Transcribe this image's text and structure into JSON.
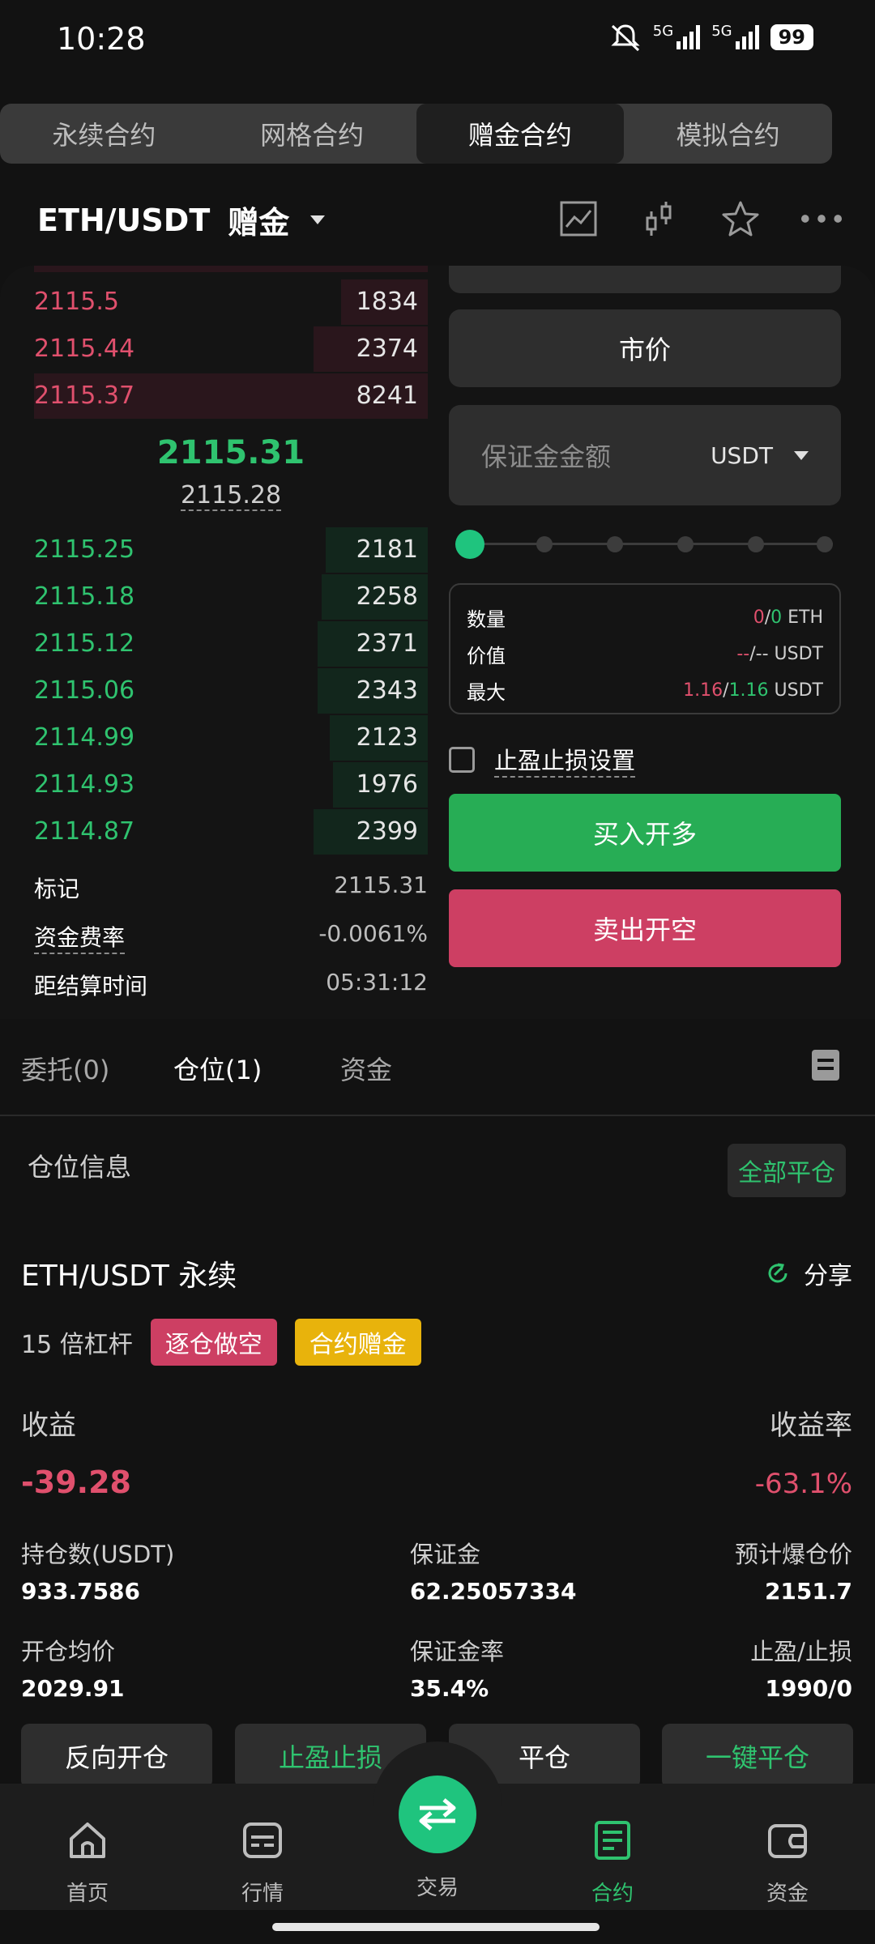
{
  "status": {
    "time": "10:28",
    "net1": "5G",
    "net2": "5G",
    "battery": "99"
  },
  "contract_tabs": [
    {
      "label": "永续合约",
      "active": false
    },
    {
      "label": "网格合约",
      "active": false
    },
    {
      "label": "赠金合约",
      "active": true
    },
    {
      "label": "模拟合约",
      "active": false
    }
  ],
  "header": {
    "pair": "ETH/USDT",
    "mode": "赠金",
    "icons": [
      "chart-icon",
      "candlestick-icon",
      "star-icon",
      "more-icon"
    ]
  },
  "orderbook": {
    "asks": [
      {
        "price": "2115.5",
        "qty": "1834",
        "depth": 0.22
      },
      {
        "price": "2115.44",
        "qty": "2374",
        "depth": 0.29
      },
      {
        "price": "2115.37",
        "qty": "8241",
        "depth": 1.0
      }
    ],
    "last_price": "2115.31",
    "mark_price": "2115.28",
    "bids": [
      {
        "price": "2115.25",
        "qty": "2181",
        "depth": 0.26
      },
      {
        "price": "2115.18",
        "qty": "2258",
        "depth": 0.27
      },
      {
        "price": "2115.12",
        "qty": "2371",
        "depth": 0.28
      },
      {
        "price": "2115.06",
        "qty": "2343",
        "depth": 0.28
      },
      {
        "price": "2114.99",
        "qty": "2123",
        "depth": 0.25
      },
      {
        "price": "2114.93",
        "qty": "1976",
        "depth": 0.24
      },
      {
        "price": "2114.87",
        "qty": "2399",
        "depth": 0.29
      }
    ],
    "mark_label": "标记",
    "mark_value": "2115.31",
    "funding_label": "资金费率",
    "funding_value": "-0.0061%",
    "settle_label": "距结算时间",
    "settle_value": "05:31:12"
  },
  "form": {
    "order_type": "市价",
    "margin_placeholder": "保证金金额",
    "margin_unit": "USDT",
    "slider_value": 0,
    "qty_label": "数量",
    "qty_a": "0",
    "qty_b": "0",
    "qty_unit": "ETH",
    "value_label": "价值",
    "value_a": "--",
    "value_b": "--",
    "value_unit": "USDT",
    "max_label": "最大",
    "max_a": "1.16",
    "max_b": "1.16",
    "max_unit": "USDT",
    "tpsl_label": "止盈止损设置",
    "buy_label": "买入开多",
    "sell_label": "卖出开空"
  },
  "bottom_tabs": {
    "orders": "委托(0)",
    "positions": "仓位(1)",
    "assets": "资金"
  },
  "position": {
    "section_title": "仓位信息",
    "close_all": "全部平仓",
    "pair": "ETH/USDT 永续",
    "share": "分享",
    "leverage": "15 倍杠杆",
    "tag_side": "逐仓做空",
    "tag_bonus": "合约赠金",
    "pnl_label": "收益",
    "pnl_value": "-39.28",
    "roe_label": "收益率",
    "roe_value": "-63.1%",
    "size_label": "持仓数(USDT)",
    "size_value": "933.7586",
    "margin_label": "保证金",
    "margin_value": "62.25057334",
    "liq_label": "预计爆仓价",
    "liq_value": "2151.7",
    "entry_label": "开仓均价",
    "entry_value": "2029.91",
    "margin_ratio_label": "保证金率",
    "margin_ratio_value": "35.4%",
    "tpsl_label": "止盈/止损",
    "tpsl_value": "1990/0",
    "actions": [
      "反向开仓",
      "止盈止损",
      "平仓",
      "一键平仓"
    ]
  },
  "nav": [
    {
      "label": "首页",
      "icon": "home-icon"
    },
    {
      "label": "行情",
      "icon": "market-icon"
    },
    {
      "label": "交易",
      "icon": "swap-icon"
    },
    {
      "label": "合约",
      "icon": "contract-icon",
      "active": true
    },
    {
      "label": "资金",
      "icon": "wallet-icon"
    }
  ],
  "colors": {
    "green": "#2fc36f",
    "red": "#e0506d",
    "accent": "#1fc47e",
    "bonus": "#e8b30c"
  }
}
